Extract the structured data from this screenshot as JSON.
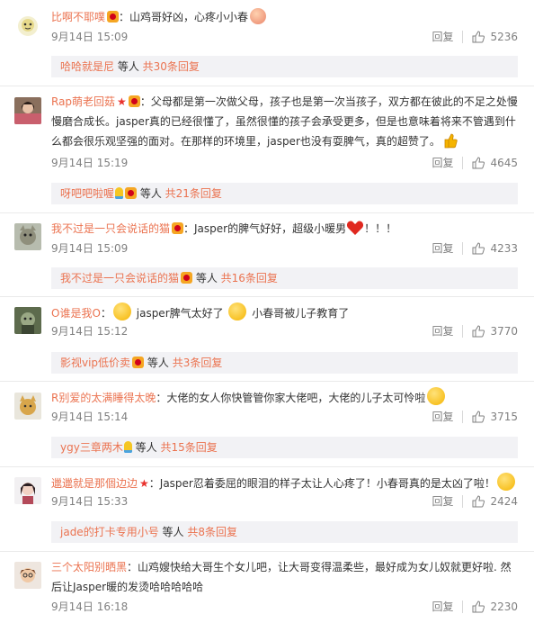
{
  "comments": [
    {
      "user": "比啊不耶噗",
      "text": "：山鸡哥好凶，心疼小小春",
      "time": "9月14日 15:09",
      "reply": "回复",
      "likes": "5236",
      "sub": {
        "user": "哈哈就是尼",
        "mid": " 等人 ",
        "more": "共30条回复"
      }
    },
    {
      "user": "Rap萌老回菇",
      "text": "：父母都是第一次做父母，孩子也是第一次当孩子，双方都在彼此的不足之处慢慢磨合成长。jasper真的已经很懂了，虽然很懂的孩子会承受更多，但是也意味着将来不管遇到什么都会很乐观坚强的面对。在那样的环境里，jasper也没有耍脾气，真的超赞了。",
      "time": "9月14日 15:19",
      "reply": "回复",
      "likes": "4645",
      "sub": {
        "user": "呀吧吧啦喔",
        "mid": " 等人 ",
        "more": "共21条回复"
      }
    },
    {
      "user": "我不过是一只会说话的猫",
      "text": "：Jasper的脾气好好，超级小暖男",
      "tail": "！！！",
      "time": "9月14日 15:09",
      "reply": "回复",
      "likes": "4233",
      "sub": {
        "user": "我不过是一只会说话的猫",
        "mid": " 等人 ",
        "more": "共16条回复"
      }
    },
    {
      "user": "O谁是我O",
      "text": "jasper脾气太好了",
      "text2": "小春哥被儿子教育了",
      "time": "9月14日 15:12",
      "reply": "回复",
      "likes": "3770",
      "sub": {
        "user": "影视vip低价卖",
        "mid": " 等人 ",
        "more": "共3条回复"
      }
    },
    {
      "user": "R别爱的太满睡得太晚",
      "text": "：大佬的女人你快管管你家大佬吧，大佬的儿子太可怜啦",
      "time": "9月14日 15:14",
      "reply": "回复",
      "likes": "3715",
      "sub": {
        "user": "ygy三章两木",
        "mid": " 等人 ",
        "more": "共15条回复"
      }
    },
    {
      "user": "邋邋就是那個边边",
      "text": "：Jasper忍着委屈的眼泪的样子太让人心疼了！小春哥真的是太凶了啦！",
      "time": "9月14日 15:33",
      "reply": "回复",
      "likes": "2424",
      "sub": {
        "user": "jade的打卡专用小号",
        "mid": " 等人 ",
        "more": "共8条回复"
      }
    },
    {
      "user": "三个太阳别晒黑",
      "text": "：山鸡嫂快给大哥生个女儿吧，让大哥变得温柔些，最好成为女儿奴就更好啦. 然后让Jasper暖的发烫哈哈哈哈哈",
      "time": "9月14日 16:18",
      "reply": "回复",
      "likes": "2230"
    }
  ],
  "colors": {
    "username": "#eb7350",
    "subbg": "#f2f2f5",
    "meta": "#808080"
  }
}
